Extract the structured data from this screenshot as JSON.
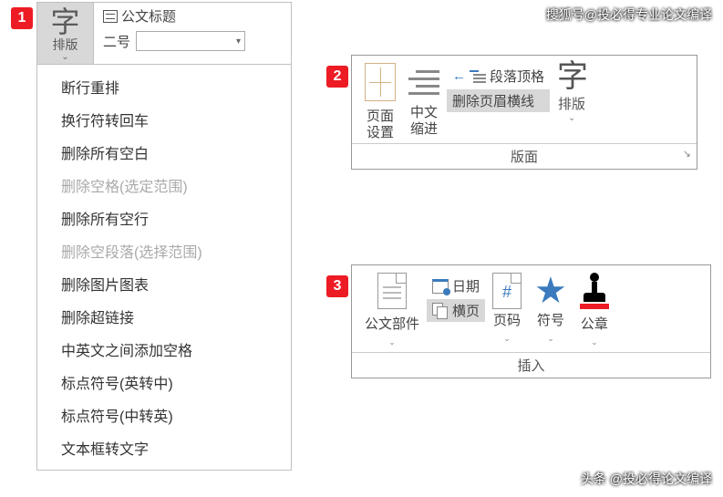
{
  "markers": {
    "m1": "1",
    "m2": "2",
    "m3": "3"
  },
  "watermarks": {
    "top": "搜狐号@投必得专业论文编译",
    "bottom": "头条 @投必得论文编译"
  },
  "panel1": {
    "button": {
      "big": "字",
      "small": "排版",
      "chev": "⌄"
    },
    "title": "公文标题",
    "fontsize": "二号",
    "dropdown_chev": "▾",
    "menu": [
      {
        "label": "断行重排",
        "enabled": true
      },
      {
        "label": "换行符转回车",
        "enabled": true
      },
      {
        "label": "删除所有空白",
        "enabled": true
      },
      {
        "label": "删除空格(选定范围)",
        "enabled": false
      },
      {
        "label": "删除所有空行",
        "enabled": true
      },
      {
        "label": "删除空段落(选择范围)",
        "enabled": false
      },
      {
        "label": "删除图片图表",
        "enabled": true
      },
      {
        "label": "删除超链接",
        "enabled": true
      },
      {
        "label": "中英文之间添加空格",
        "enabled": true
      },
      {
        "label": "标点符号(英转中)",
        "enabled": true
      },
      {
        "label": "标点符号(中转英)",
        "enabled": true
      },
      {
        "label": "文本框转文字",
        "enabled": true
      }
    ]
  },
  "panel2": {
    "page_setup": "页面\n设置",
    "cn_indent": "中文\n缩进",
    "para_topfmt": "段落顶格",
    "arrow_left": "←",
    "del_header_line": "删除页眉横线",
    "zi": {
      "big": "字",
      "small": "排版",
      "chev": "⌄"
    },
    "group": "版面",
    "launcher": "↘"
  },
  "panel3": {
    "doc_parts": "公文部件",
    "date": "日期",
    "landscape": "横页",
    "page_num": "页码",
    "symbol": "符号",
    "stamp": "公章",
    "chev": "⌄",
    "hash": "#",
    "star": "★",
    "group": "插入"
  }
}
